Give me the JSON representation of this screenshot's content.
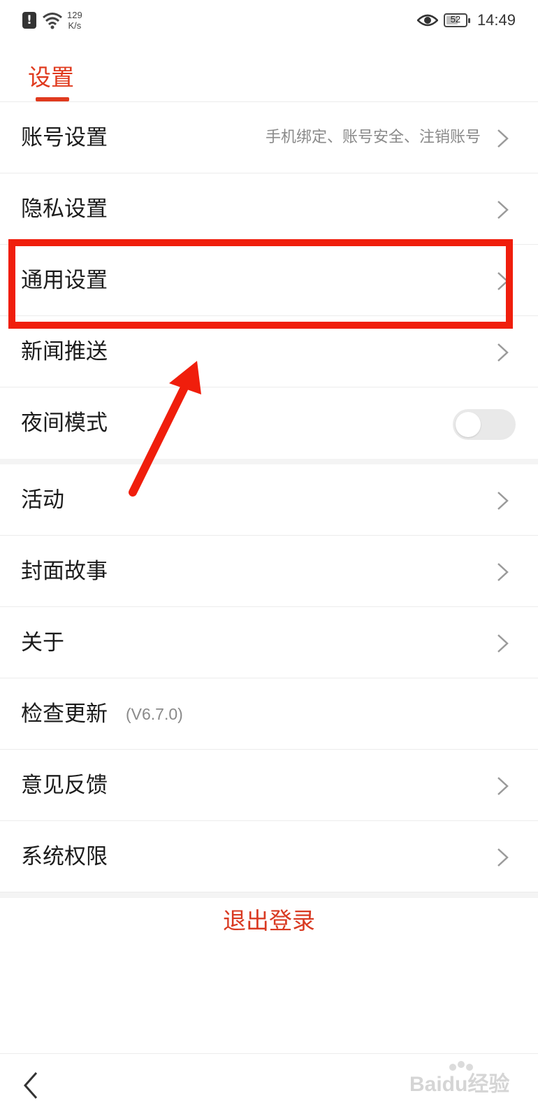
{
  "status_bar": {
    "speed_value": "129",
    "speed_unit": "K/s",
    "battery": "52",
    "time": "14:49",
    "icons": [
      "notification-icon",
      "wifi-icon",
      "eye-icon",
      "battery-icon"
    ]
  },
  "header": {
    "tab": "设置"
  },
  "menu": [
    {
      "label": "账号设置",
      "sub": "手机绑定、账号安全、注销账号"
    },
    {
      "label": "隐私设置"
    },
    {
      "label": "通用设置"
    },
    {
      "label": "新闻推送"
    },
    {
      "label": "夜间模式",
      "toggle": false
    },
    {
      "label": "活动"
    },
    {
      "label": "封面故事"
    },
    {
      "label": "关于"
    },
    {
      "label": "检查更新",
      "version": "(V6.7.0)"
    },
    {
      "label": "意见反馈"
    },
    {
      "label": "系统权限"
    }
  ],
  "logout": "退出登录",
  "watermark": "Baidu经验",
  "colors": {
    "accent": "#e03a1e",
    "annotation": "#f01e0c"
  }
}
